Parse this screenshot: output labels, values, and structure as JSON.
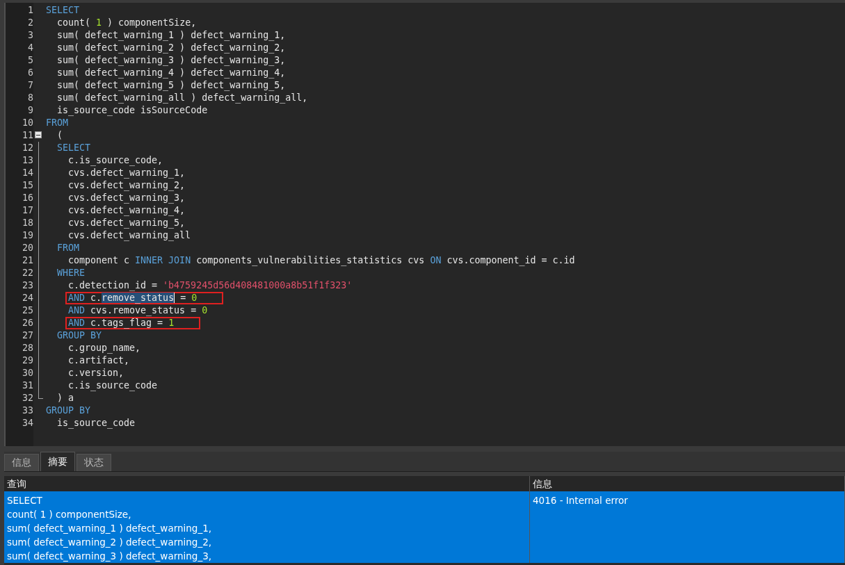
{
  "editor": {
    "lines": [
      {
        "number": "1",
        "tokens": [
          {
            "kind": "keyword",
            "text": "SELECT"
          }
        ],
        "children": [
          {
            "number": "2",
            "tokens": [
              {
                "kind": "plain",
                "text": "count( "
              },
              {
                "kind": "number",
                "text": "1"
              },
              {
                "kind": "plain",
                "text": " ) componentSize,"
              }
            ]
          },
          {
            "number": "3",
            "tokens": [
              {
                "kind": "plain",
                "text": "sum( defect_warning_1 ) defect_warning_1,"
              }
            ]
          },
          {
            "number": "4",
            "tokens": [
              {
                "kind": "plain",
                "text": "sum( defect_warning_2 ) defect_warning_2,"
              }
            ]
          },
          {
            "number": "5",
            "tokens": [
              {
                "kind": "plain",
                "text": "sum( defect_warning_3 ) defect_warning_3,"
              }
            ]
          },
          {
            "number": "6",
            "tokens": [
              {
                "kind": "plain",
                "text": "sum( defect_warning_4 ) defect_warning_4,"
              }
            ]
          },
          {
            "number": "7",
            "tokens": [
              {
                "kind": "plain",
                "text": "sum( defect_warning_5 ) defect_warning_5,"
              }
            ]
          },
          {
            "number": "8",
            "tokens": [
              {
                "kind": "plain",
                "text": "sum( defect_warning_all ) defect_warning_all,"
              }
            ]
          },
          {
            "number": "9",
            "tokens": [
              {
                "kind": "plain",
                "text": "is_source_code isSourceCode"
              }
            ]
          }
        ]
      },
      {
        "number": "10",
        "tokens": [
          {
            "kind": "keyword",
            "text": "FROM"
          }
        ],
        "children": [
          {
            "number": "11",
            "fold_start": true,
            "tokens": [
              {
                "kind": "plain",
                "text": "("
              }
            ]
          },
          {
            "number": "12",
            "in_fold": true,
            "tokens": [
              {
                "kind": "keyword",
                "text": "SELECT"
              }
            ],
            "children": [
              {
                "number": "13",
                "in_fold": true,
                "tokens": [
                  {
                    "kind": "plain",
                    "text": "c.is_source_code,"
                  }
                ]
              },
              {
                "number": "14",
                "in_fold": true,
                "tokens": [
                  {
                    "kind": "plain",
                    "text": "cvs.defect_warning_1,"
                  }
                ]
              },
              {
                "number": "15",
                "in_fold": true,
                "tokens": [
                  {
                    "kind": "plain",
                    "text": "cvs.defect_warning_2,"
                  }
                ]
              },
              {
                "number": "16",
                "in_fold": true,
                "tokens": [
                  {
                    "kind": "plain",
                    "text": "cvs.defect_warning_3,"
                  }
                ]
              },
              {
                "number": "17",
                "in_fold": true,
                "tokens": [
                  {
                    "kind": "plain",
                    "text": "cvs.defect_warning_4,"
                  }
                ]
              },
              {
                "number": "18",
                "in_fold": true,
                "tokens": [
                  {
                    "kind": "plain",
                    "text": "cvs.defect_warning_5,"
                  }
                ]
              },
              {
                "number": "19",
                "in_fold": true,
                "tokens": [
                  {
                    "kind": "plain",
                    "text": "cvs.defect_warning_all"
                  }
                ]
              }
            ]
          },
          {
            "number": "20",
            "in_fold": true,
            "tokens": [
              {
                "kind": "keyword",
                "text": "FROM"
              }
            ],
            "children": [
              {
                "number": "21",
                "in_fold": true,
                "tokens": [
                  {
                    "kind": "plain",
                    "text": "component c "
                  },
                  {
                    "kind": "keyword",
                    "text": "INNER JOIN"
                  },
                  {
                    "kind": "plain",
                    "text": " components_vulnerabilities_statistics cvs "
                  },
                  {
                    "kind": "keyword",
                    "text": "ON"
                  },
                  {
                    "kind": "plain",
                    "text": " cvs.component_id = c.id"
                  }
                ]
              }
            ]
          },
          {
            "number": "22",
            "in_fold": true,
            "tokens": [
              {
                "kind": "keyword",
                "text": "WHERE"
              }
            ],
            "children": [
              {
                "number": "23",
                "in_fold": true,
                "tokens": [
                  {
                    "kind": "plain",
                    "text": "c.detection_id = "
                  },
                  {
                    "kind": "string",
                    "text": "'b4759245d56d408481000a8b51f1f323'"
                  }
                ]
              },
              {
                "number": "24",
                "in_fold": true,
                "boxed": true,
                "tokens": [
                  {
                    "kind": "keyword",
                    "text": "AND"
                  },
                  {
                    "kind": "plain",
                    "text": " c."
                  },
                  {
                    "kind": "selected",
                    "text": "remove_status"
                  },
                  {
                    "kind": "plain",
                    "text": " = "
                  },
                  {
                    "kind": "number",
                    "text": "0"
                  }
                ]
              },
              {
                "number": "25",
                "in_fold": true,
                "tokens": [
                  {
                    "kind": "keyword",
                    "text": "AND"
                  },
                  {
                    "kind": "plain",
                    "text": " cvs.remove_status = "
                  },
                  {
                    "kind": "number",
                    "text": "0"
                  }
                ]
              },
              {
                "number": "26",
                "in_fold": true,
                "boxed": true,
                "tokens": [
                  {
                    "kind": "keyword",
                    "text": "AND"
                  },
                  {
                    "kind": "plain",
                    "text": " c.tags_flag = "
                  },
                  {
                    "kind": "number",
                    "text": "1"
                  }
                ]
              }
            ]
          },
          {
            "number": "27",
            "in_fold": true,
            "tokens": [
              {
                "kind": "keyword",
                "text": "GROUP BY"
              }
            ],
            "children": [
              {
                "number": "28",
                "in_fold": true,
                "tokens": [
                  {
                    "kind": "plain",
                    "text": "c.group_name,"
                  }
                ]
              },
              {
                "number": "29",
                "in_fold": true,
                "tokens": [
                  {
                    "kind": "plain",
                    "text": "c.artifact,"
                  }
                ]
              },
              {
                "number": "30",
                "in_fold": true,
                "tokens": [
                  {
                    "kind": "plain",
                    "text": "c.version,"
                  }
                ]
              },
              {
                "number": "31",
                "in_fold": true,
                "tokens": [
                  {
                    "kind": "plain",
                    "text": "c.is_source_code"
                  }
                ]
              }
            ]
          },
          {
            "number": "32",
            "fold_end": true,
            "tokens": [
              {
                "kind": "plain",
                "text": ") a"
              }
            ]
          }
        ]
      },
      {
        "number": "33",
        "tokens": [
          {
            "kind": "keyword",
            "text": "GROUP BY"
          }
        ],
        "children": [
          {
            "number": "34",
            "tokens": [
              {
                "kind": "plain",
                "text": "is_source_code"
              }
            ]
          }
        ]
      }
    ]
  },
  "tabs": [
    {
      "label": "信息",
      "selected": false
    },
    {
      "label": "摘要",
      "selected": true
    },
    {
      "label": "状态",
      "selected": false
    }
  ],
  "results": {
    "columns": [
      "查询",
      "信息"
    ],
    "rows": [
      {
        "selected": true,
        "query_lines": [
          "SELECT",
          "count( 1 ) componentSize,",
          "sum( defect_warning_1 ) defect_warning_1,",
          "sum( defect_warning_2 ) defect_warning_2,",
          "sum( defect_warning_3 ) defect_warning_3,"
        ],
        "message": "4016 - Internal error"
      }
    ]
  }
}
